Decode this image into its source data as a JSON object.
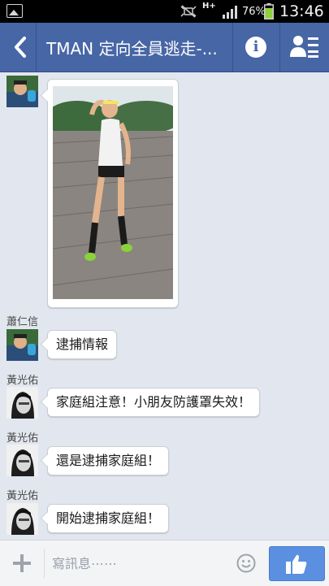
{
  "status_bar": {
    "network": "H+",
    "battery_percent": "76%",
    "battery_level": 0.76,
    "time": "13:46",
    "icons": [
      "gallery-icon",
      "mute-icon",
      "signal-icon",
      "battery-icon"
    ]
  },
  "header": {
    "title": "TMAN 定向全員逃走-...",
    "icons": [
      "back-arrow-icon",
      "info-icon",
      "members-list-icon"
    ],
    "accent_color": "#4766a5"
  },
  "messages": [
    {
      "type": "photo",
      "sender": ""
    },
    {
      "type": "text",
      "sender": "蕭仁信",
      "text": "逮捕情報"
    },
    {
      "type": "text",
      "sender": "黃光佑",
      "text": "家庭組注意！小朋友防護罩失效！"
    },
    {
      "type": "text",
      "sender": "黃光佑",
      "text": "還是逮捕家庭組！"
    },
    {
      "type": "text",
      "sender": "黃光佑",
      "text": "開始逮捕家庭組！"
    }
  ],
  "composer": {
    "placeholder": "寫訊息⋯⋯",
    "icons": [
      "plus-icon",
      "emoji-icon",
      "thumbs-up-icon"
    ],
    "like_button_color": "#5b8fe0"
  }
}
